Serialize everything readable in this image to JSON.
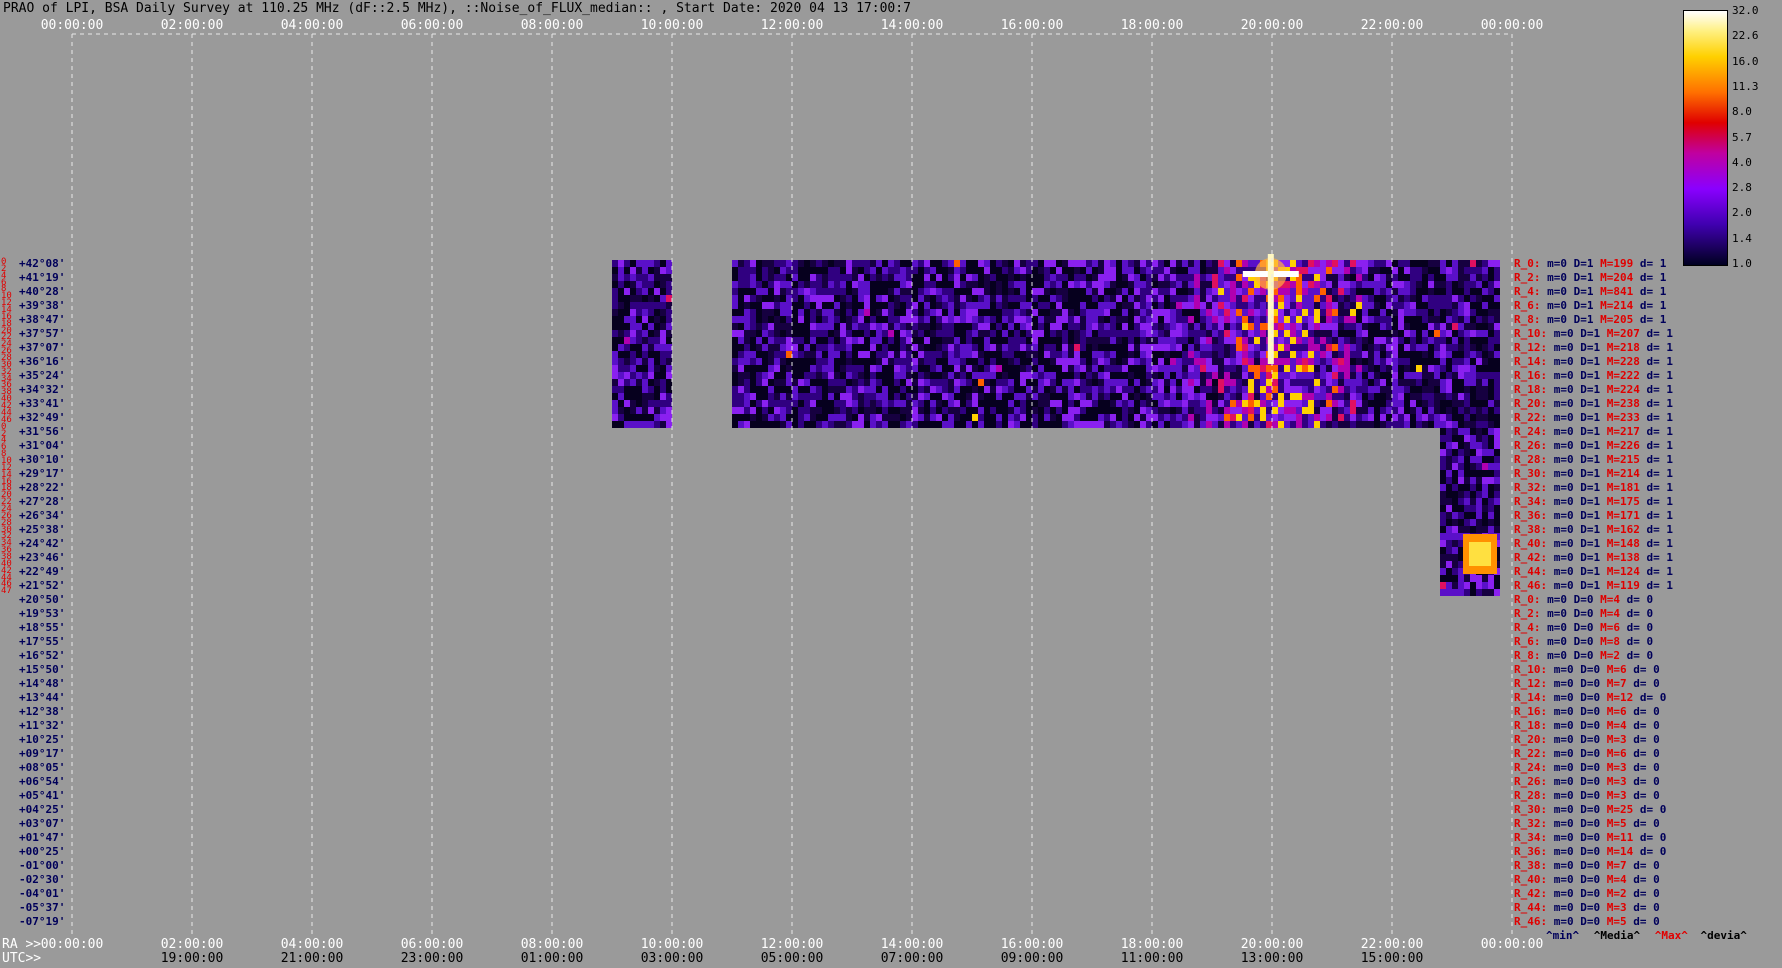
{
  "title": "PRAO of LPI, BSA Daily Survey at 110.25 MHz (dF::2.5 MHz), ::Noise_of_FLUX_median:: , Start Date: 2020 04 13 17:00:7",
  "chart_data": {
    "type": "heatmap",
    "title": "PRAO of LPI, BSA Daily Survey at 110.25 MHz (dF::2.5 MHz), ::Noise_of_FLUX_median:: , Start Date: 2020 04 13 17:00:7",
    "x_top_ticks": [
      "00:00:00",
      "02:00:00",
      "04:00:00",
      "06:00:00",
      "08:00:00",
      "10:00:00",
      "12:00:00",
      "14:00:00",
      "16:00:00",
      "18:00:00",
      "20:00:00",
      "22:00:00",
      "00:00:00"
    ],
    "x_ra_ticks": [
      "00:00:00",
      "02:00:00",
      "04:00:00",
      "06:00:00",
      "08:00:00",
      "10:00:00",
      "12:00:00",
      "14:00:00",
      "16:00:00",
      "18:00:00",
      "20:00:00",
      "22:00:00",
      "00:00:00"
    ],
    "x_utc_ticks": [
      "",
      "19:00:00",
      "21:00:00",
      "23:00:00",
      "01:00:00",
      "03:00:00",
      "05:00:00",
      "07:00:00",
      "09:00:00",
      "11:00:00",
      "13:00:00",
      "15:00:00",
      ""
    ],
    "x_range_hours": [
      0,
      24
    ],
    "ra_axis_label": "RA >>",
    "utc_axis_label": "UTC>>",
    "declinations": [
      "+42°08'",
      "+41°19'",
      "+40°28'",
      "+39°38'",
      "+38°47'",
      "+37°57'",
      "+37°07'",
      "+36°16'",
      "+35°24'",
      "+34°32'",
      "+33°41'",
      "+32°49'",
      "+31°56'",
      "+31°04'",
      "+30°10'",
      "+29°17'",
      "+28°22'",
      "+27°28'",
      "+26°34'",
      "+25°38'",
      "+24°42'",
      "+23°46'",
      "+22°49'",
      "+21°52'",
      "+20°50'",
      "+19°53'",
      "+18°55'",
      "+17°55'",
      "+16°52'",
      "+15°50'",
      "+14°48'",
      "+13°44'",
      "+12°38'",
      "+11°32'",
      "+10°25'",
      "+09°17'",
      "+08°05'",
      "+06°54'",
      "+05°41'",
      "+04°25'",
      "+03°07'",
      "+01°47'",
      "+00°25'",
      "-01°00'",
      "-02°30'",
      "-04°01'",
      "-05°37'",
      "-07°19'"
    ],
    "row_numbers": [
      "0",
      "2",
      "4",
      "6",
      "8",
      "10",
      "12",
      "14",
      "16",
      "18",
      "20",
      "22",
      "24",
      "26",
      "28",
      "30",
      "32",
      "34",
      "36",
      "38",
      "40",
      "42",
      "44",
      "46",
      "0",
      "2",
      "4",
      "6",
      "8",
      "10",
      "12",
      "14",
      "16",
      "18",
      "20",
      "22",
      "24",
      "26",
      "28",
      "30",
      "32",
      "34",
      "36",
      "38",
      "40",
      "42",
      "44",
      "46",
      "47"
    ],
    "row_stats": [
      {
        "r": "R_0:",
        "m": "m=0",
        "D": "D=1",
        "M": "M=199",
        "d": "d= 1"
      },
      {
        "r": "R_2:",
        "m": "m=0",
        "D": "D=1",
        "M": "M=204",
        "d": "d= 1"
      },
      {
        "r": "R_4:",
        "m": "m=0",
        "D": "D=1",
        "M": "M=841",
        "d": "d= 1"
      },
      {
        "r": "R_6:",
        "m": "m=0",
        "D": "D=1",
        "M": "M=214",
        "d": "d= 1"
      },
      {
        "r": "R_8:",
        "m": "m=0",
        "D": "D=1",
        "M": "M=205",
        "d": "d= 1"
      },
      {
        "r": "R_10:",
        "m": "m=0",
        "D": "D=1",
        "M": "M=207",
        "d": "d= 1"
      },
      {
        "r": "R_12:",
        "m": "m=0",
        "D": "D=1",
        "M": "M=218",
        "d": "d= 1"
      },
      {
        "r": "R_14:",
        "m": "m=0",
        "D": "D=1",
        "M": "M=228",
        "d": "d= 1"
      },
      {
        "r": "R_16:",
        "m": "m=0",
        "D": "D=1",
        "M": "M=222",
        "d": "d= 1"
      },
      {
        "r": "R_18:",
        "m": "m=0",
        "D": "D=1",
        "M": "M=224",
        "d": "d= 1"
      },
      {
        "r": "R_20:",
        "m": "m=0",
        "D": "D=1",
        "M": "M=238",
        "d": "d= 1"
      },
      {
        "r": "R_22:",
        "m": "m=0",
        "D": "D=1",
        "M": "M=233",
        "d": "d= 1"
      },
      {
        "r": "R_24:",
        "m": "m=0",
        "D": "D=1",
        "M": "M=217",
        "d": "d= 1"
      },
      {
        "r": "R_26:",
        "m": "m=0",
        "D": "D=1",
        "M": "M=226",
        "d": "d= 1"
      },
      {
        "r": "R_28:",
        "m": "m=0",
        "D": "D=1",
        "M": "M=215",
        "d": "d= 1"
      },
      {
        "r": "R_30:",
        "m": "m=0",
        "D": "D=1",
        "M": "M=214",
        "d": "d= 1"
      },
      {
        "r": "R_32:",
        "m": "m=0",
        "D": "D=1",
        "M": "M=181",
        "d": "d= 1"
      },
      {
        "r": "R_34:",
        "m": "m=0",
        "D": "D=1",
        "M": "M=175",
        "d": "d= 1"
      },
      {
        "r": "R_36:",
        "m": "m=0",
        "D": "D=1",
        "M": "M=171",
        "d": "d= 1"
      },
      {
        "r": "R_38:",
        "m": "m=0",
        "D": "D=1",
        "M": "M=162",
        "d": "d= 1"
      },
      {
        "r": "R_40:",
        "m": "m=0",
        "D": "D=1",
        "M": "M=148",
        "d": "d= 1"
      },
      {
        "r": "R_42:",
        "m": "m=0",
        "D": "D=1",
        "M": "M=138",
        "d": "d= 1"
      },
      {
        "r": "R_44:",
        "m": "m=0",
        "D": "D=1",
        "M": "M=124",
        "d": "d= 1"
      },
      {
        "r": "R_46:",
        "m": "m=0",
        "D": "D=1",
        "M": "M=119",
        "d": "d= 1"
      },
      {
        "r": "R_0:",
        "m": "m=0",
        "D": "D=0",
        "M": "M=4",
        "d": "d= 0"
      },
      {
        "r": "R_2:",
        "m": "m=0",
        "D": "D=0",
        "M": "M=4",
        "d": "d= 0"
      },
      {
        "r": "R_4:",
        "m": "m=0",
        "D": "D=0",
        "M": "M=6",
        "d": "d= 0"
      },
      {
        "r": "R_6:",
        "m": "m=0",
        "D": "D=0",
        "M": "M=8",
        "d": "d= 0"
      },
      {
        "r": "R_8:",
        "m": "m=0",
        "D": "D=0",
        "M": "M=2",
        "d": "d= 0"
      },
      {
        "r": "R_10:",
        "m": "m=0",
        "D": "D=0",
        "M": "M=6",
        "d": "d= 0"
      },
      {
        "r": "R_12:",
        "m": "m=0",
        "D": "D=0",
        "M": "M=7",
        "d": "d= 0"
      },
      {
        "r": "R_14:",
        "m": "m=0",
        "D": "D=0",
        "M": "M=12",
        "d": "d= 0"
      },
      {
        "r": "R_16:",
        "m": "m=0",
        "D": "D=0",
        "M": "M=6",
        "d": "d= 0"
      },
      {
        "r": "R_18:",
        "m": "m=0",
        "D": "D=0",
        "M": "M=4",
        "d": "d= 0"
      },
      {
        "r": "R_20:",
        "m": "m=0",
        "D": "D=0",
        "M": "M=3",
        "d": "d= 0"
      },
      {
        "r": "R_22:",
        "m": "m=0",
        "D": "D=0",
        "M": "M=6",
        "d": "d= 0"
      },
      {
        "r": "R_24:",
        "m": "m=0",
        "D": "D=0",
        "M": "M=3",
        "d": "d= 0"
      },
      {
        "r": "R_26:",
        "m": "m=0",
        "D": "D=0",
        "M": "M=3",
        "d": "d= 0"
      },
      {
        "r": "R_28:",
        "m": "m=0",
        "D": "D=0",
        "M": "M=3",
        "d": "d= 0"
      },
      {
        "r": "R_30:",
        "m": "m=0",
        "D": "D=0",
        "M": "M=25",
        "d": "d= 0"
      },
      {
        "r": "R_32:",
        "m": "m=0",
        "D": "D=0",
        "M": "M=5",
        "d": "d= 0"
      },
      {
        "r": "R_34:",
        "m": "m=0",
        "D": "D=0",
        "M": "M=11",
        "d": "d= 0"
      },
      {
        "r": "R_36:",
        "m": "m=0",
        "D": "D=0",
        "M": "M=14",
        "d": "d= 0"
      },
      {
        "r": "R_38:",
        "m": "m=0",
        "D": "D=0",
        "M": "M=7",
        "d": "d= 0"
      },
      {
        "r": "R_40:",
        "m": "m=0",
        "D": "D=0",
        "M": "M=4",
        "d": "d= 0"
      },
      {
        "r": "R_42:",
        "m": "m=0",
        "D": "D=0",
        "M": "M=2",
        "d": "d= 0"
      },
      {
        "r": "R_44:",
        "m": "m=0",
        "D": "D=0",
        "M": "M=3",
        "d": "d= 0"
      },
      {
        "r": "R_46:",
        "m": "m=0",
        "D": "D=0",
        "M": "M=5",
        "d": "d= 0"
      }
    ],
    "stats_legend": {
      "min": "^min^",
      "median": "^Media^",
      "max": "^Max^",
      "devia": "^devia^"
    },
    "colorbar_labels": [
      "32.0",
      "22.6",
      "16.0",
      "11.3",
      "8.0",
      "5.7",
      "4.0",
      "2.8",
      "2.0",
      "1.4",
      "1.0"
    ],
    "data_blocks": [
      {
        "ra_start_h": 9.0,
        "ra_end_h": 10.0,
        "dec_rows": [
          0,
          24
        ]
      },
      {
        "ra_start_h": 11.0,
        "ra_end_h": 22.8,
        "dec_rows": [
          0,
          24
        ]
      },
      {
        "ra_start_h": 22.8,
        "ra_end_h": 23.8,
        "dec_rows": [
          0,
          48
        ]
      }
    ],
    "bright_sources": [
      {
        "ra_h": 19.98,
        "dec_row": 2,
        "level": "max"
      },
      {
        "ra_h": 23.45,
        "dec_row": 42,
        "level": "high"
      }
    ],
    "colors": {
      "background": "#9a9a9a",
      "row_num": "#e00000",
      "dec_label": "#00005a"
    }
  }
}
